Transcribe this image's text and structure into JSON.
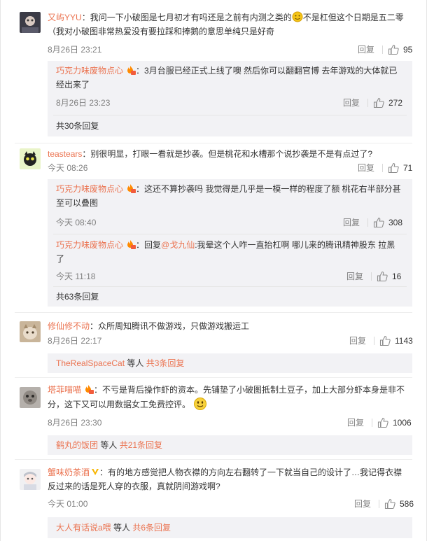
{
  "comments": [
    {
      "user": "又屿YYU",
      "text1": "：我问一下小破图是七月初才有吗还是之前有内测之类的",
      "text1b": "不是杠但这个日期是五二零",
      "text2": "（我对小破图非常热爱没有要拉踩和捧鹅的意思单纯只是好奇",
      "time": "8月26日 23:21",
      "reply": "回复",
      "likes": "95",
      "subs": [
        {
          "user": "巧克力味废物点心",
          "text1": "：3月台服已经正式上线了噢 然后你可以翻翻官博 去年游戏的大体就已",
          "text2": "经出来了",
          "time": "8月26日 23:23",
          "reply": "回复",
          "likes": "272"
        }
      ],
      "more": "共30条回复"
    },
    {
      "user": "teastears",
      "text1": "：别很明显，打眼一看就是抄袭。但是桃花和水槽那个说抄袭是不是有点过了?",
      "time": "今天 08:26",
      "reply": "回复",
      "likes": "71",
      "subs": [
        {
          "user": "巧克力味废物点心",
          "text1": "：这还不算抄袭吗 我觉得是几乎是一模一样的程度了额 桃花右半部分甚",
          "text2": "至可以叠图",
          "time": "今天 08:40",
          "reply": "回复",
          "likes": "308"
        },
        {
          "user": "巧克力味废物点心",
          "pre": "：回复",
          "mention": "@戈九仙",
          "text1": ":我晕这个人咋一直抬杠啊 哪儿来的腾讯精神股东 拉黑",
          "text2": "了",
          "time": "今天 11:18",
          "reply": "回复",
          "likes": "16"
        }
      ],
      "more": "共63条回复"
    },
    {
      "user": "修仙修不动",
      "text1": "：众所周知腾讯不做游戏，只做游戏搬运工",
      "time": "8月26日 22:17",
      "reply": "回复",
      "likes": "1143",
      "more_user": "TheRealSpaceCat",
      "more_mid": " 等人 ",
      "more": "共3条回复"
    },
    {
      "user": "塔菲喵喵",
      "text1": "：不亏是背后操作虾的资本。先铺垫了小破图抵制土豆子，加上大部分虾本身是非不",
      "text2": "分，这下又可以用数据女工免费控评。",
      "time": "8月26日 23:30",
      "reply": "回复",
      "likes": "1006",
      "more_user": "鹤丸的饭团",
      "more_mid": " 等人 ",
      "more": "共21条回复"
    },
    {
      "user": "蟹味奶茶酒",
      "text1": "：有的地方感觉把人物衣襟的方向左右翻转了一下就当自己的设计了…我记得衣襟",
      "text2": "反过来的话是死人穿的衣服，真就阴间游戏啊?",
      "time": "今天 01:00",
      "reply": "回复",
      "likes": "586",
      "more_user": "大人有话说a喂",
      "more_mid": " 等人 ",
      "more": "共6条回复"
    }
  ],
  "colors": {
    "username": "#eb7350",
    "accent_link": "#eb7350",
    "subbox_bg": "#f2f2f5"
  },
  "icons": [
    "thumbs-up-icon",
    "fire-badge-icon",
    "smile-emoji-icon",
    "verified-v-icon"
  ]
}
